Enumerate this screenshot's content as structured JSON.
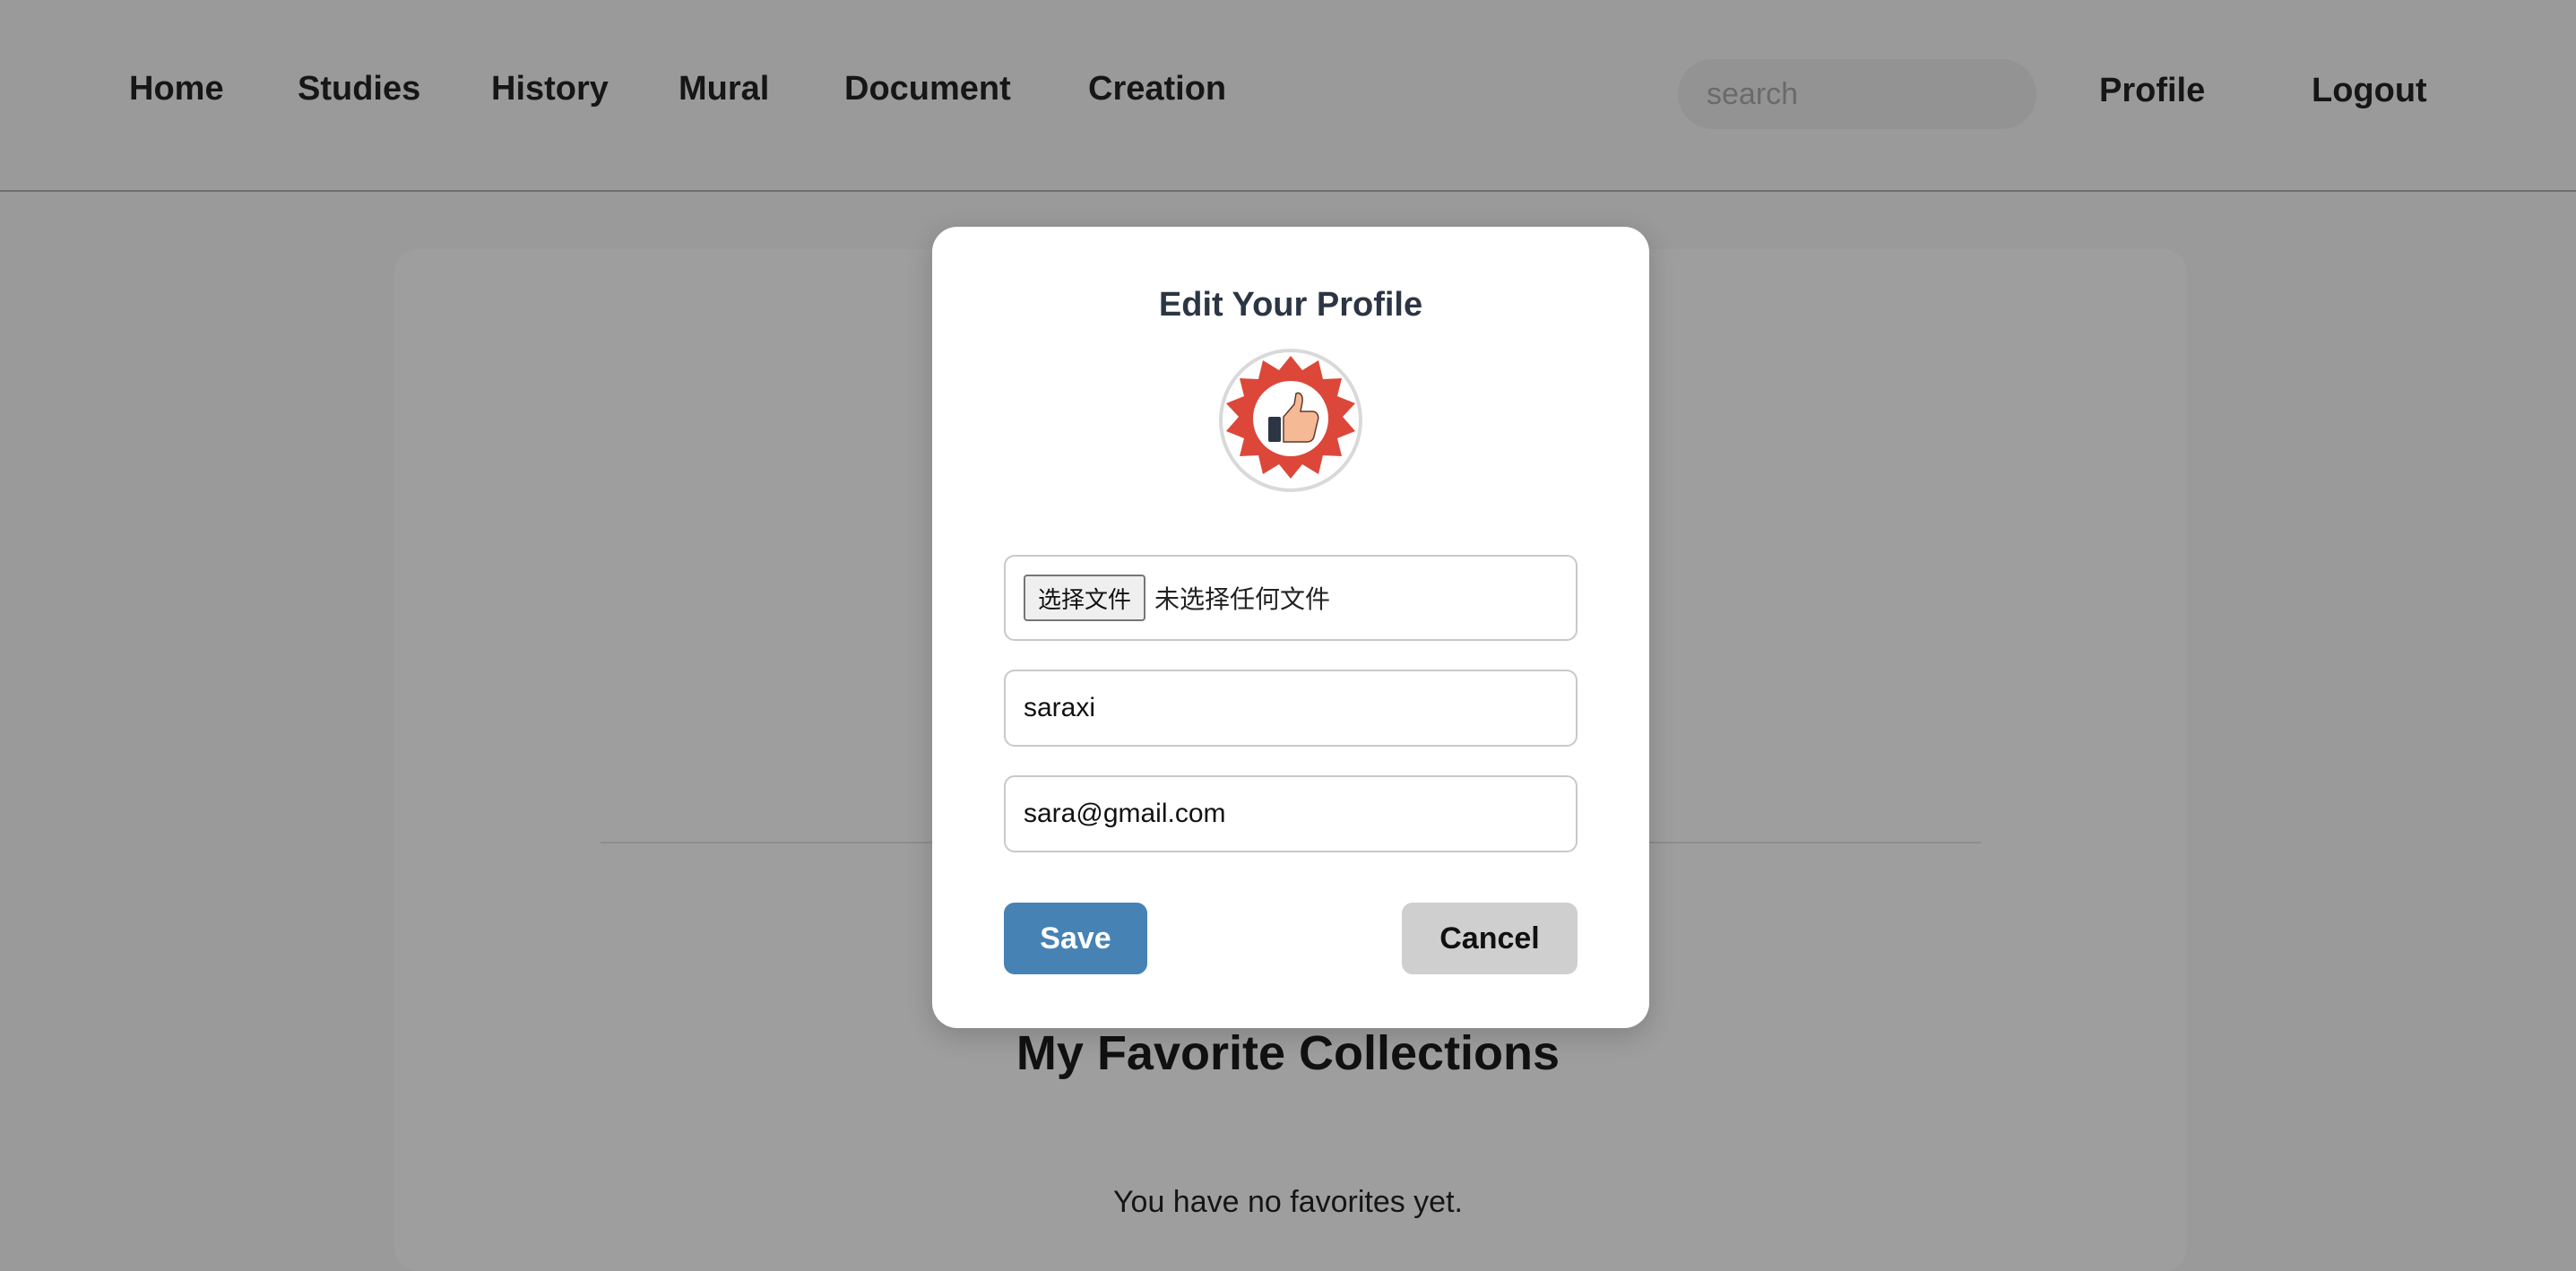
{
  "nav": {
    "items": [
      "Home",
      "Studies",
      "History",
      "Mural",
      "Document",
      "Creation"
    ],
    "search_placeholder": "search",
    "profile_label": "Profile",
    "logout_label": "Logout"
  },
  "page": {
    "favorites_title": "My Favorite Collections",
    "favorites_empty": "You have no favorites yet."
  },
  "modal": {
    "title": "Edit Your Profile",
    "avatar_icon": "thumbs-up-badge-icon",
    "file_button_label": "选择文件",
    "file_status": "未选择任何文件",
    "username_value": "saraxi",
    "email_value": "sara@gmail.com",
    "save_label": "Save",
    "cancel_label": "Cancel"
  },
  "colors": {
    "overlay": "#9a9a9a",
    "save_button": "#4782b5",
    "cancel_button": "#cfcfcf",
    "badge_red": "#dc473a"
  }
}
